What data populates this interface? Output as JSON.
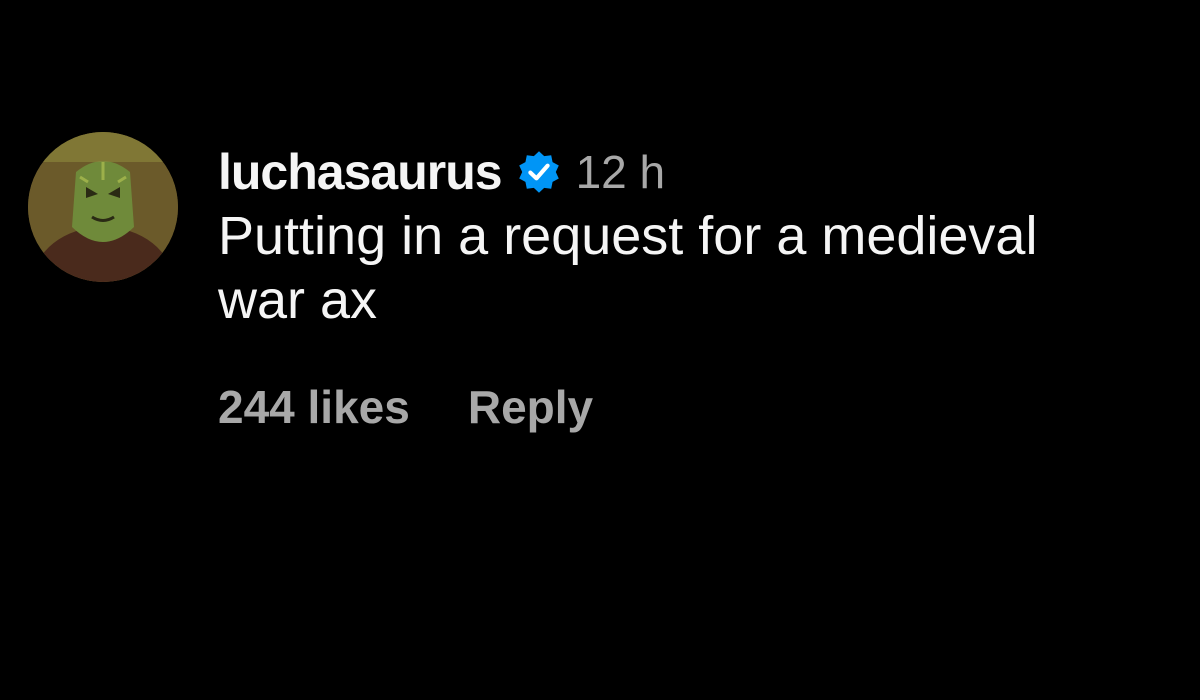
{
  "comment": {
    "username": "luchasaurus",
    "verified_icon": "verified-badge-icon",
    "timestamp": "12 h",
    "text": "Putting in a request for a medieval war ax",
    "likes": "244 likes",
    "reply_label": "Reply"
  },
  "colors": {
    "background": "#000000",
    "primary_text": "#f5f5f5",
    "secondary_text": "#a8a8a8",
    "verified": "#0095f6"
  }
}
